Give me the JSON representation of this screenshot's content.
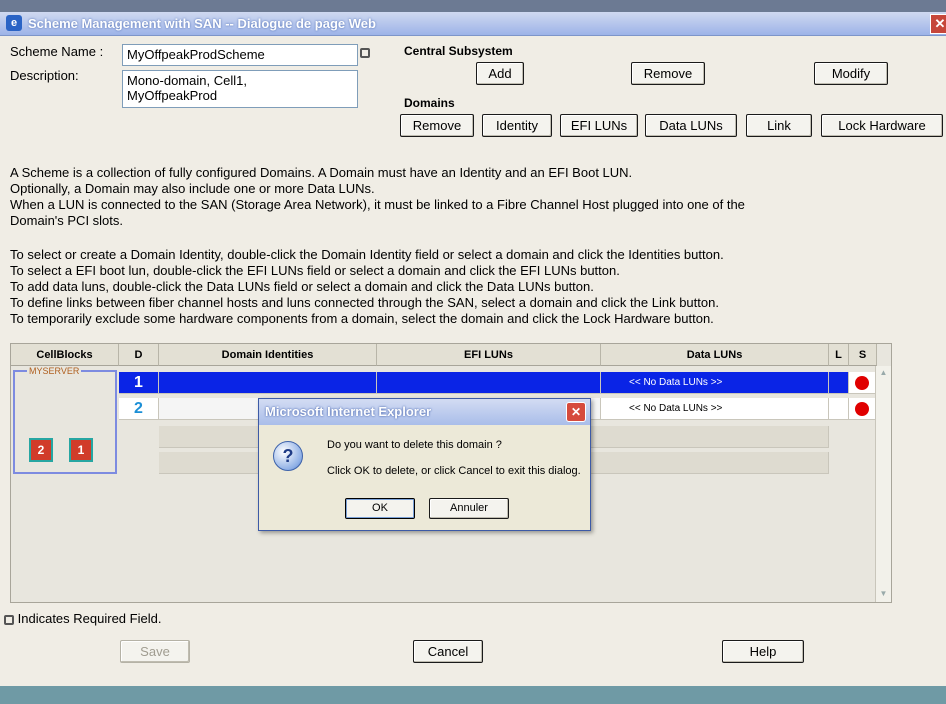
{
  "window": {
    "title": "Scheme Management with SAN -- Dialogue de page Web",
    "close_label": "✕"
  },
  "form": {
    "scheme_name_label": "Scheme Name :",
    "scheme_name_value": "MyOffpeakProdScheme",
    "description_label": "Description:",
    "description_value": "Mono-domain, Cell1,\nMyOffpeakProd"
  },
  "central_subsystem": {
    "label": "Central Subsystem",
    "add": "Add",
    "remove": "Remove",
    "modify": "Modify"
  },
  "domains": {
    "label": "Domains",
    "remove": "Remove",
    "identity": "Identity",
    "efi_luns": "EFI LUNs",
    "data_luns": "Data LUNs",
    "link": "Link",
    "lock_hardware": "Lock Hardware"
  },
  "info_paragraph_1": "A Scheme is a collection of fully configured Domains. A Domain must have an Identity and an EFI Boot LUN.\nOptionally, a Domain may also include one or more Data LUNs.\nWhen a LUN is connected to the SAN (Storage Area Network), it must be linked to a Fibre Channel Host plugged into one of the\nDomain's PCI slots.",
  "info_paragraph_2": "To select or create a Domain Identity, double-click the Domain Identity field or select a domain and click the Identities button.\nTo select a EFI boot lun, double-click the EFI LUNs field or select a domain and click the EFI LUNs button.\nTo add data luns, double-click the Data LUNs field or select a domain and click the Data LUNs button.\nTo define links between fiber channel hosts and luns connected through the SAN, select a domain and click the Link button.\nTo temporarily exclude some hardware components from a domain, select the domain and click the Lock Hardware button.",
  "grid": {
    "headers": {
      "cellblocks": "CellBlocks",
      "d": "D",
      "identities": "Domain Identities",
      "efi": "EFI LUNs",
      "data": "Data LUNs",
      "l": "L",
      "s": "S"
    },
    "server_label": "MYSERVER",
    "cellblock_icons": [
      "2",
      "1"
    ],
    "rows": [
      {
        "d": "1",
        "data": "<< No Data LUNs >>"
      },
      {
        "d": "2",
        "data": "<< No Data LUNs >>"
      }
    ]
  },
  "required_note": "Indicates Required Field.",
  "footer": {
    "save": "Save",
    "cancel": "Cancel",
    "help": "Help"
  },
  "dialog": {
    "title": "Microsoft Internet Explorer",
    "question": "Do you want to delete this domain ?",
    "hint": "Click OK to delete, or click Cancel to exit this dialog.",
    "ok": "OK",
    "cancel": "Annuler"
  },
  "colors": {
    "selection": "#0a24e6",
    "status_red": "#e00000",
    "title_blue": "#9db3e8"
  }
}
